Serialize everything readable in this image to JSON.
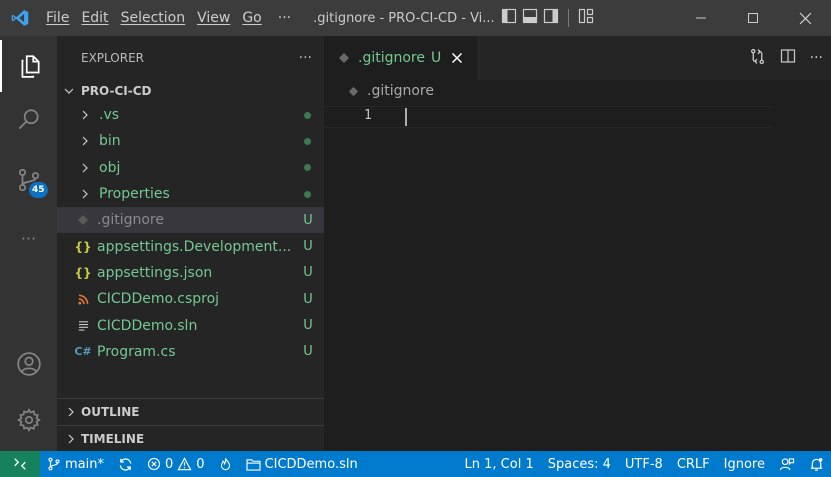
{
  "titlebar": {
    "menu": [
      "File",
      "Edit",
      "Selection",
      "View",
      "Go"
    ],
    "more": "···",
    "title": ".gitignore - PRO-CI-CD - Vi..."
  },
  "activity": {
    "scm_badge": "45",
    "more": "···"
  },
  "sidebar": {
    "header": "EXPLORER",
    "header_more": "···",
    "root": "PRO-CI-CD",
    "folders": [
      {
        "name": ".vs"
      },
      {
        "name": "bin"
      },
      {
        "name": "obj"
      },
      {
        "name": "Properties"
      }
    ],
    "files": [
      {
        "name": ".gitignore",
        "status": "U"
      },
      {
        "name": "appsettings.Development...",
        "status": "U",
        "icon_text": "{}"
      },
      {
        "name": "appsettings.json",
        "status": "U",
        "icon_text": "{}"
      },
      {
        "name": "CICDDemo.csproj",
        "status": "U"
      },
      {
        "name": "CICDDemo.sln",
        "status": "U"
      },
      {
        "name": "Program.cs",
        "status": "U",
        "icon_text": "C#"
      }
    ],
    "outline": "OUTLINE",
    "timeline": "TIMELINE"
  },
  "editor": {
    "tab_name": ".gitignore",
    "tab_status": "U",
    "breadcrumb": ".gitignore",
    "line_number": "1"
  },
  "statusbar": {
    "branch": "main*",
    "errors": "0",
    "warnings": "0",
    "solution": "CICDDemo.sln",
    "position": "Ln 1, Col 1",
    "spaces": "Spaces: 4",
    "encoding": "UTF-8",
    "eol": "CRLF",
    "language": "Ignore"
  },
  "colors": {
    "accent": "#007acc",
    "remote": "#16825d",
    "untracked": "#73c991",
    "badge": "#0e70c0",
    "json_icon": "#cbcb41",
    "csharp_icon": "#519aba",
    "rss_icon": "#e37933"
  }
}
